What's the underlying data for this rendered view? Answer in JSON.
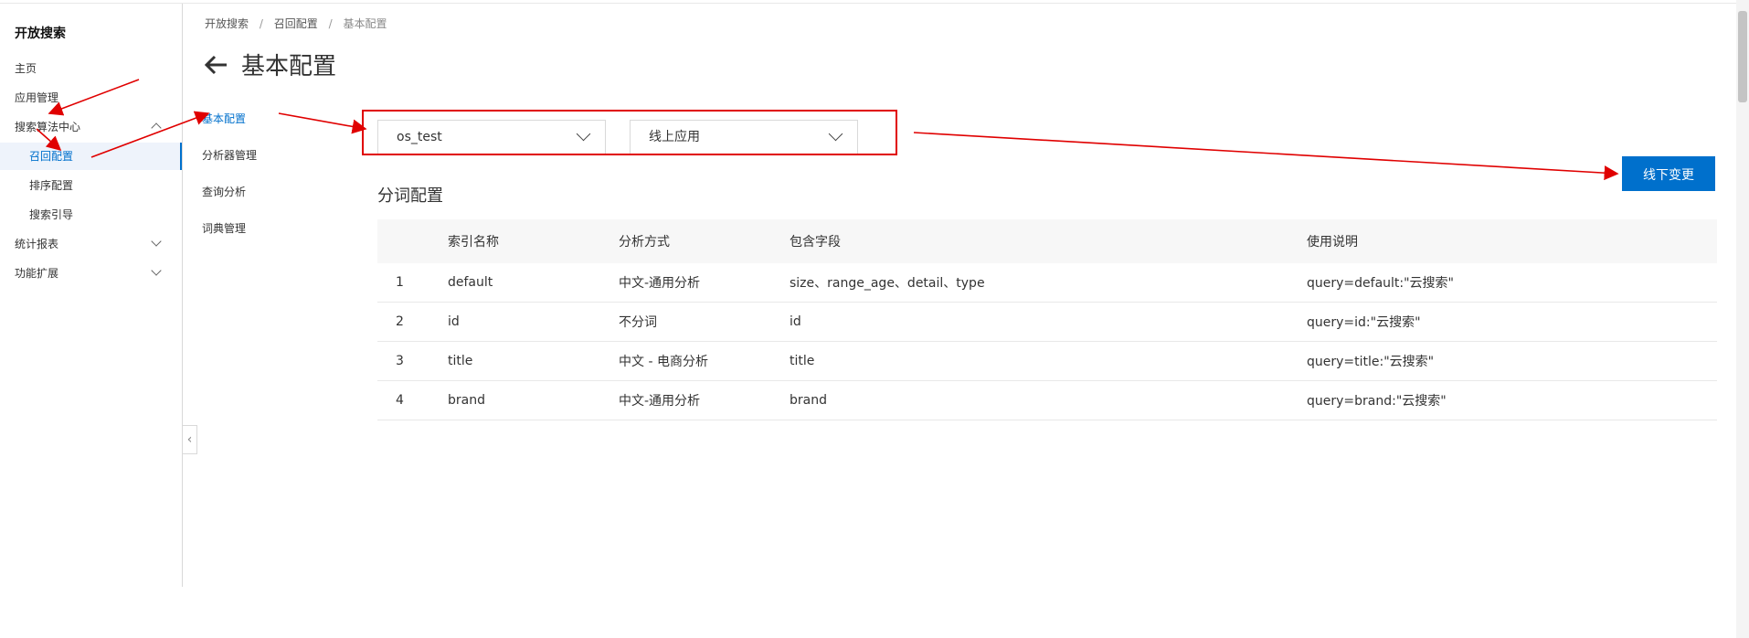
{
  "app_title": "开放搜索",
  "sidebar": {
    "items": [
      {
        "label": "主页"
      },
      {
        "label": "应用管理"
      },
      {
        "label": "搜索算法中心"
      },
      {
        "label": "召回配置"
      },
      {
        "label": "排序配置"
      },
      {
        "label": "搜索引导"
      },
      {
        "label": "统计报表"
      },
      {
        "label": "功能扩展"
      }
    ]
  },
  "breadcrumb": [
    "开放搜索",
    "召回配置",
    "基本配置"
  ],
  "breadcrumb_sep": "/",
  "page_title": "基本配置",
  "subnav": [
    "基本配置",
    "分析器管理",
    "查询分析",
    "词典管理"
  ],
  "selects": {
    "app_name": "os_test",
    "app_version": "线上应用"
  },
  "offline_button": "线下变更",
  "section_title": "分词配置",
  "table": {
    "headers": [
      "",
      "索引名称",
      "分析方式",
      "包含字段",
      "使用说明"
    ],
    "rows": [
      [
        "1",
        "default",
        "中文-通用分析",
        "size、range_age、detail、type",
        "query=default:\"云搜索\""
      ],
      [
        "2",
        "id",
        "不分词",
        "id",
        "query=id:\"云搜索\""
      ],
      [
        "3",
        "title",
        "中文 - 电商分析",
        "title",
        "query=title:\"云搜索\""
      ],
      [
        "4",
        "brand",
        "中文-通用分析",
        "brand",
        "query=brand:\"云搜索\""
      ]
    ]
  },
  "colors": {
    "primary": "#0070cc",
    "annotation": "#e00000"
  }
}
